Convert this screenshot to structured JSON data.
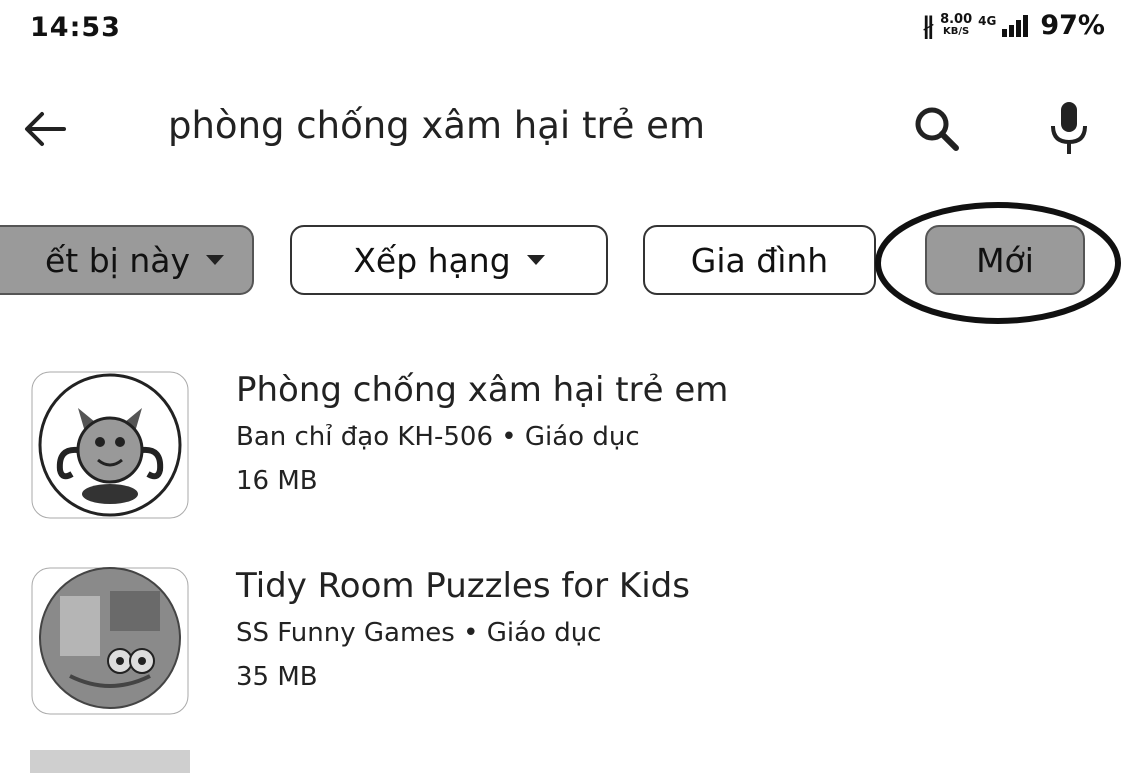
{
  "status_bar": {
    "time": "14:53",
    "bluetooth_icon": "bluetooth-icon",
    "net_speed": "8.00",
    "net_speed_unit": "KB/S",
    "network_type": "4G",
    "signal_icon": "signal-bars-icon",
    "battery": "97%"
  },
  "search": {
    "query": "phòng chống xâm hại trẻ em",
    "back_icon": "arrow-left-icon",
    "search_icon": "search-icon",
    "mic_icon": "microphone-icon"
  },
  "filters": [
    {
      "label": "ết bị này",
      "dropdown": true,
      "selected": true
    },
    {
      "label": "Xếp hạng",
      "dropdown": true,
      "selected": false
    },
    {
      "label": "Gia đình",
      "dropdown": false,
      "selected": false
    },
    {
      "label": "Mới",
      "dropdown": false,
      "selected": true
    }
  ],
  "results": [
    {
      "title": "Phòng chống xâm hại trẻ em",
      "developer": "Ban chỉ đạo KH-506",
      "category": "Giáo dục",
      "separator": "•",
      "size": "16 MB",
      "icon": "cartoon-mascot-icon"
    },
    {
      "title": "Tidy Room Puzzles for Kids",
      "developer": "SS Funny Games",
      "category": "Giáo dục",
      "separator": "•",
      "size": "35 MB",
      "icon": "puzzle-room-icon"
    }
  ],
  "colors": {
    "selected_chip": "#9a9a9a",
    "text": "#222222",
    "background": "#ffffff"
  }
}
